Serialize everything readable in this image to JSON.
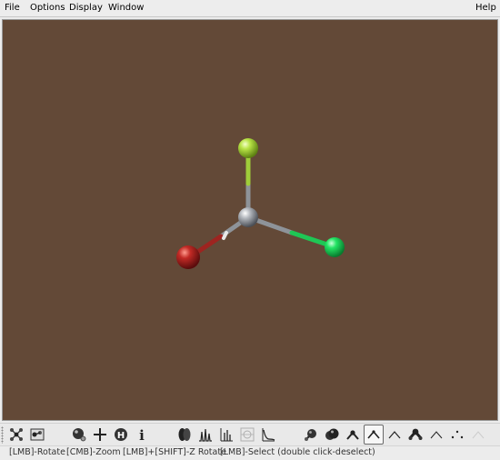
{
  "menubar": {
    "items": [
      "File",
      "Options",
      "Display",
      "Window"
    ],
    "help": "Help"
  },
  "viewport": {
    "background": "#634937",
    "molecule": {
      "atoms": [
        {
          "element": "C",
          "color": "#8a8f97"
        },
        {
          "element": "Cl",
          "color": "#a6d633"
        },
        {
          "element": "F",
          "color": "#1ede5c"
        },
        {
          "element": "Br",
          "color": "#b82222"
        },
        {
          "element": "H",
          "color": "#e8e8e8"
        }
      ]
    }
  },
  "toolbar": {
    "groups": [
      {
        "buttons": [
          "molecule-tree-icon",
          "molecule-view-icon"
        ]
      },
      {
        "buttons": [
          "ball-render-icon",
          "crosshair-icon",
          "hydrogen-icon",
          "info-icon"
        ]
      },
      {
        "buttons": [
          "orbitals-icon",
          "spectrum-icon",
          "ir-spectrum-icon",
          "surface-icon",
          "plot-icon"
        ]
      },
      {
        "buttons": [
          "ball-and-stick-icon",
          "space-fill-icon",
          "stick-icon",
          "wire-bond-icon",
          "wire-icon",
          "tube-icon",
          "line-icon",
          "dots-icon",
          "disabled-tool-icon"
        ]
      }
    ],
    "active_button": "wire-bond-icon"
  },
  "statusbar": {
    "hints": [
      "[LMB]-Rotate",
      "[CMB]-Zoom",
      "[LMB]+[SHIFT]-Z Rotate",
      "[LMB]-Select (double click-deselect)"
    ]
  }
}
